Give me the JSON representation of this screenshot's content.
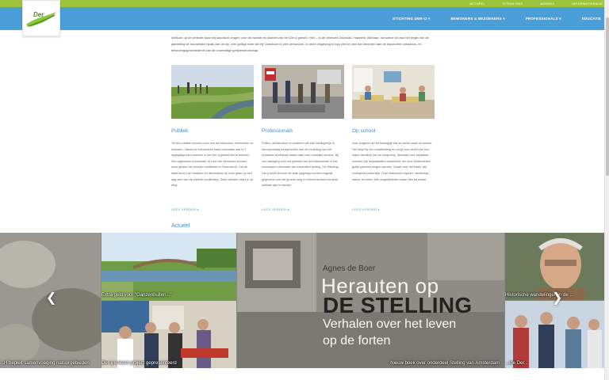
{
  "header": {
    "logo_text": "Der",
    "top_links": [
      "Actueel",
      "Steun ons",
      "Agenda",
      "Informatiebalie"
    ],
    "menu": [
      "Stichting Der-ij ▾",
      "Bewoners & bezoekers ▾",
      "Professionals ▾",
      "Educatie"
    ]
  },
  "intro": "Welkom op de website waar wij aandacht vragen voor de handel en wandel van het Der-ij gebied. Hier – in de driehoek Zaandad, Haarlem, Alkmaar- stroomde tot aan het begin van de jaartelling de noordelijke rijdak van de rijn, een grillige rivier die bij Castricum in zee uitmondde. In deze omgeving is nog veel te zien dat herinnert aan de bijzondere ontstaans- en bewoningsgeschiedenis van dit voormalige getijdenlandschap.",
  "columns": [
    {
      "title": "Publiek",
      "text": "Tot het publiek behoren voor ons de bewoners, recreanten en toeristen. Vanuit de interactieve kaart bovenaan laat ik 't opgejaagd zien hoeveel in het Der-ij gebied wel te beleven. We organiseren excursies. Al voor vier personen kunnen onze gidsen uw hoeveel ontdekken in Noordrecht. Via de kaart kunt u de vindbare en adresbasis op zoek gaan op een dag zien van de elekele rondleiding. Deze website helpt je op weg.",
      "more": "Lees verder ▸"
    },
    {
      "title": "Professionals",
      "text": "Politici, ambtenaren en anderen die zich bezisgetrijk of beroepsmatig bezighouden met de inrichting van het schaarse landschap staan vaak voor moeilijke keuzes. Bij hun afweging over het gebruik van de buitenruimte is het noodzaken informatie van essentieel belang. De Stichting Der-ij heeft zichzelf de taak opgelegd zoveel mogelijk gegevens over de groene long in Kennemerland via deze website aan te bieden.",
      "more": "Lees verder ▸"
    },
    {
      "title": "Op school",
      "text": "Voor jongeren is het belangrijk dat ze weten waar ze wonen. Het helpt bij hun ontwikkeling en zorgt voor besef van hun eigen identiteit van de omgeving. Speciaal voor bepaalde scholen zijn lespakketten ontwikkeld, die door leerkrachten gratis gebruikt mogen worden. Zowel voor het basis- als voortgezet onderwijs. Over historische figuren, landschap, natuur en meer. Alle mogelijkheden staan hier bij elkaar.",
      "more": "Lees verder ▸"
    }
  ],
  "news_title": "Actueel",
  "carousel": {
    "left_caption": "...H bepleit samenvoeging natuurgebieden",
    "top_caption": "Extra geld voor \"Ganzenbuiten...\"",
    "bottom_caption": "Der-ij e-learn project gepresenteerd",
    "main_caption": "Nieuw boek over onderdeel Stelling van Amsterdam",
    "right_top_caption": "Historische wandelingen in de ...",
    "right_bottom_caption": "...ine Der...",
    "book": {
      "author": "Agnes de Boer",
      "title_line1": "Herauten op",
      "title_line2": "DE STELLING",
      "subtitle_line1": "Verhalen over het leven",
      "subtitle_line2": "op de forten"
    },
    "prev_icon": "❮",
    "next_icon": "❯"
  },
  "colors": {
    "top_green": "#9dc43a",
    "nav_blue": "#4a9fd8",
    "heading_blue": "#3a8fd0"
  }
}
